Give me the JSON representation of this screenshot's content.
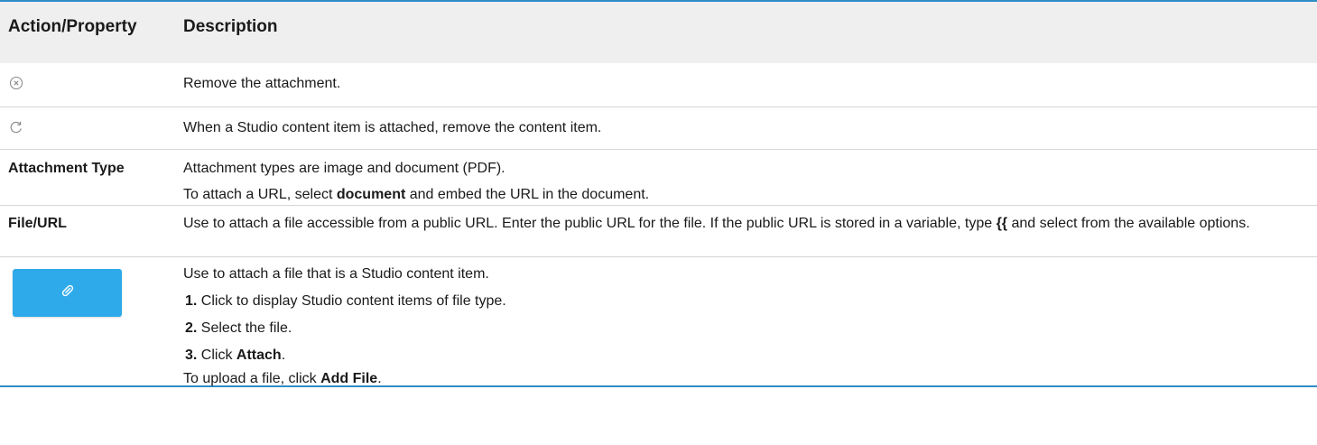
{
  "header": {
    "col1": "Action/Property",
    "col2": "Description"
  },
  "rows": {
    "remove": {
      "icon": "close-circle-icon",
      "desc": "Remove the attachment."
    },
    "refresh": {
      "icon": "refresh-icon",
      "desc": "When a Studio content item is attached, remove the content item."
    },
    "type": {
      "label": "Attachment Type",
      "line1": "Attachment types are image and document (PDF).",
      "line2_pre": "To attach a URL, select ",
      "line2_bold": "document",
      "line2_post": " and embed the URL in the document."
    },
    "file": {
      "label": "File/URL",
      "desc_pre": "Use to attach a file accessible from a public URL. Enter the public URL for the file. If the public URL is stored in a variable, type ",
      "desc_bold": "{{",
      "desc_post": " and select from the available options."
    },
    "attach": {
      "button_icon": "paperclip-icon",
      "button_color": "#2eaaeb",
      "intro": "Use to attach a file that is a Studio content item.",
      "steps": [
        {
          "num": "1.",
          "text": " Click to display Studio content items of file type."
        },
        {
          "num": "2.",
          "text": " Select the file."
        },
        {
          "num": "3.",
          "text_pre": " Click ",
          "text_bold": "Attach",
          "text_post": "."
        }
      ],
      "upload_pre": "To upload a file, click ",
      "upload_bold": "Add File",
      "upload_post": "."
    }
  },
  "colors": {
    "accent_border": "#2f8dc8",
    "header_bg": "#efefef"
  }
}
